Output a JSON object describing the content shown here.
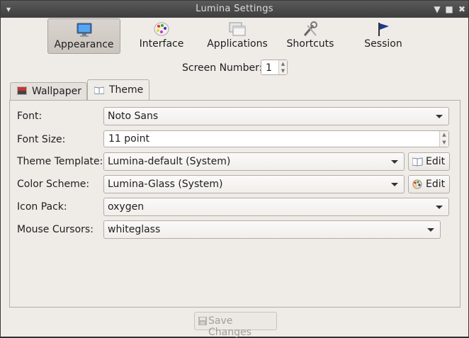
{
  "window": {
    "title": "Lumina Settings"
  },
  "toolbar": {
    "items": [
      {
        "label": "Appearance",
        "icon": "monitor-icon",
        "active": true
      },
      {
        "label": "Interface",
        "icon": "palette-icon",
        "active": false
      },
      {
        "label": "Applications",
        "icon": "windows-icon",
        "active": false
      },
      {
        "label": "Shortcuts",
        "icon": "tools-icon",
        "active": false
      },
      {
        "label": "Session",
        "icon": "flag-icon",
        "active": false
      }
    ]
  },
  "screen": {
    "label": "Screen Number:",
    "value": "1"
  },
  "tabs": [
    {
      "label": "Wallpaper",
      "icon": "wallpaper-icon",
      "active": false
    },
    {
      "label": "Theme",
      "icon": "book-icon",
      "active": true
    }
  ],
  "theme": {
    "font": {
      "label": "Font:",
      "value": "Noto Sans"
    },
    "font_size": {
      "label": "Font Size:",
      "value": "11 point"
    },
    "template": {
      "label": "Theme Template:",
      "value": "Lumina-default (System)",
      "edit_label": "Edit"
    },
    "color_scheme": {
      "label": "Color Scheme:",
      "value": "Lumina-Glass (System)",
      "edit_label": "Edit"
    },
    "icon_pack": {
      "label": "Icon Pack:",
      "value": "oxygen"
    },
    "cursors": {
      "label": "Mouse Cursors:",
      "value": "whiteglass"
    }
  },
  "footer": {
    "save_label": "Save Changes"
  },
  "colors": {
    "window_bg": "#efebe7",
    "titlebar": "#3e3e3e",
    "accent_flag": "#1a3a8a"
  }
}
